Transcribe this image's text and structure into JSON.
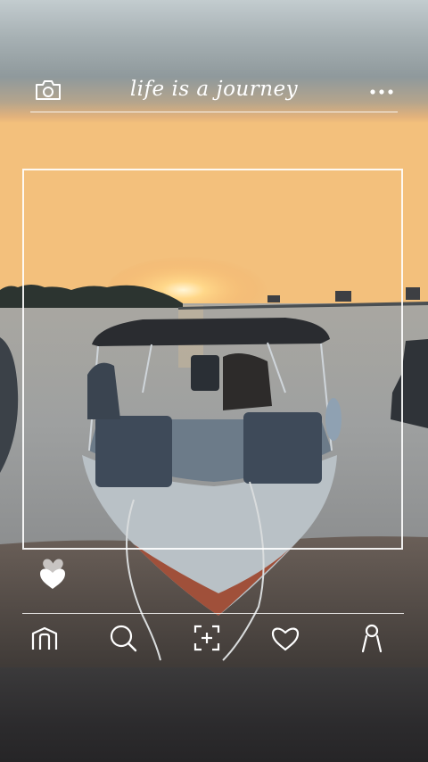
{
  "header": {
    "title": "life is a journey",
    "camera_icon": "camera-icon",
    "more_icon": "more-dots-icon"
  },
  "actions": {
    "like_icon": "heart-filled-icon"
  },
  "nav": {
    "items": [
      {
        "icon": "home-icon"
      },
      {
        "icon": "search-icon"
      },
      {
        "icon": "add-post-icon"
      },
      {
        "icon": "heart-outline-icon"
      },
      {
        "icon": "profile-icon"
      }
    ]
  },
  "colors": {
    "overlay_line": "#ffffff",
    "sky_top": "#9aa7ae",
    "sunset_glow": "#f2b15e",
    "water": "#9fa2a3"
  }
}
